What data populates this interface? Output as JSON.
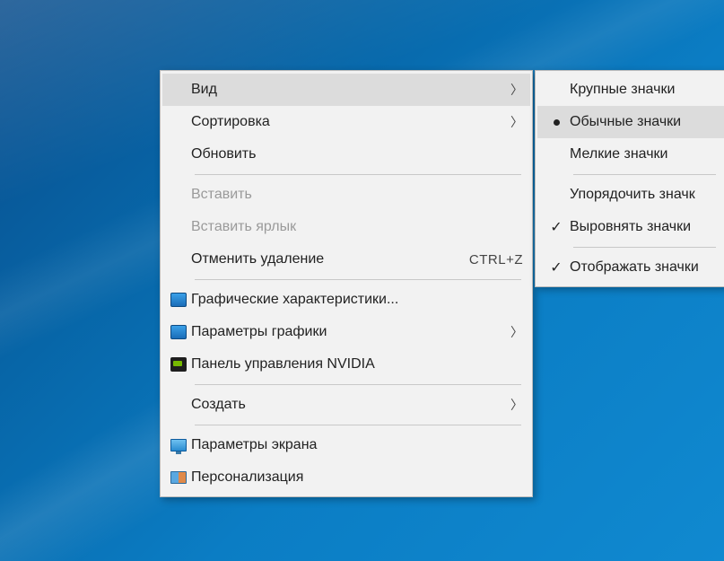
{
  "primary": {
    "items": [
      {
        "label": "Вид",
        "hasSubmenu": true,
        "highlighted": true
      },
      {
        "label": "Сортировка",
        "hasSubmenu": true
      },
      {
        "label": "Обновить"
      }
    ],
    "group2": [
      {
        "label": "Вставить",
        "disabled": true
      },
      {
        "label": "Вставить ярлык",
        "disabled": true
      },
      {
        "label": "Отменить удаление",
        "shortcut": "CTRL+Z"
      }
    ],
    "group3": [
      {
        "label": "Графические характеристики...",
        "icon": "intel"
      },
      {
        "label": "Параметры графики",
        "icon": "intel",
        "hasSubmenu": true
      },
      {
        "label": "Панель управления NVIDIA",
        "icon": "nvidia"
      }
    ],
    "group4": [
      {
        "label": "Создать",
        "hasSubmenu": true
      }
    ],
    "group5": [
      {
        "label": "Параметры экрана",
        "icon": "monitor"
      },
      {
        "label": "Персонализация",
        "icon": "personalize"
      }
    ]
  },
  "submenu": {
    "sizes": [
      {
        "label": "Крупные значки"
      },
      {
        "label": "Обычные значки",
        "selected": true,
        "highlighted": true
      },
      {
        "label": "Мелкие значки"
      }
    ],
    "arrange": [
      {
        "label": "Упорядочить значк"
      },
      {
        "label": "Выровнять значки",
        "checked": true
      }
    ],
    "show": [
      {
        "label": "Отображать значки",
        "checked": true
      }
    ]
  }
}
